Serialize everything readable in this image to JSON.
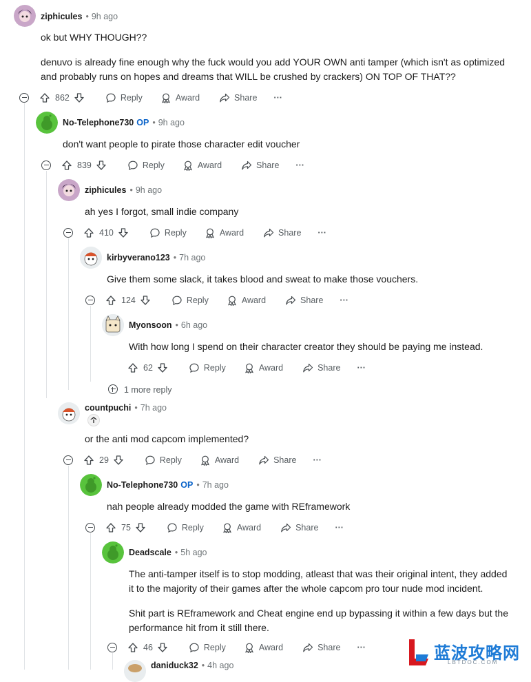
{
  "comments": [
    {
      "user": "ziphicules",
      "op": "",
      "time": "9h ago",
      "lines": [
        "ok but WHY THOUGH??",
        "",
        "denuvo is already fine enough why the fuck would you add YOUR OWN anti tamper (which isn't as optimized",
        "and probably runs on hopes and dreams that WILL be crushed by crackers) ON TOP OF THAT??"
      ],
      "votes": "862"
    },
    {
      "user": "No-Telephone730",
      "op": "OP",
      "time": "9h ago",
      "lines": [
        "don't want people to pirate those character edit voucher"
      ],
      "votes": "839"
    },
    {
      "user": "ziphicules",
      "op": "",
      "time": "9h ago",
      "lines": [
        "ah yes I forgot, small indie company"
      ],
      "votes": "410"
    },
    {
      "user": "kirbyverano123",
      "op": "",
      "time": "7h ago",
      "lines": [
        "Give them some slack, it takes blood and sweat to make those vouchers."
      ],
      "votes": "124"
    },
    {
      "user": "Myonsoon",
      "op": "",
      "time": "6h ago",
      "lines": [
        "With how long I spend on their character creator they should be paying me instead."
      ],
      "votes": "62"
    },
    {
      "user": "countpuchi",
      "op": "",
      "time": "7h ago",
      "lines": [
        "or the anti mod capcom implemented?"
      ],
      "votes": "29"
    },
    {
      "user": "No-Telephone730",
      "op": "OP",
      "time": "7h ago",
      "lines": [
        "nah people already modded the game with REframework"
      ],
      "votes": "75"
    },
    {
      "user": "Deadscale",
      "op": "",
      "time": "5h ago",
      "lines": [
        "The anti-tamper itself is to stop modding, atleast that was their original intent, they added",
        "it to the majority of their games after the whole capcom pro tour nude mod incident.",
        "",
        "Shit part is REframework and Cheat engine end up bypassing it within a few days but the",
        "performance hit from it still there."
      ],
      "votes": "46"
    },
    {
      "user": "daniduck32",
      "op": "",
      "time": "4h ago",
      "lines": [],
      "votes": ""
    }
  ],
  "actions": {
    "reply": "Reply",
    "award": "Award",
    "share": "Share",
    "more": "···"
  },
  "more_replies": "1 more reply",
  "meta_separator": "•",
  "watermark": {
    "title": "蓝波攻略网",
    "sub": "LBTDOC.COM"
  },
  "colors": {
    "op_blue": "#0a63c9",
    "snoo_green": "#58c33c",
    "thread_line": "#e0e3e6"
  }
}
